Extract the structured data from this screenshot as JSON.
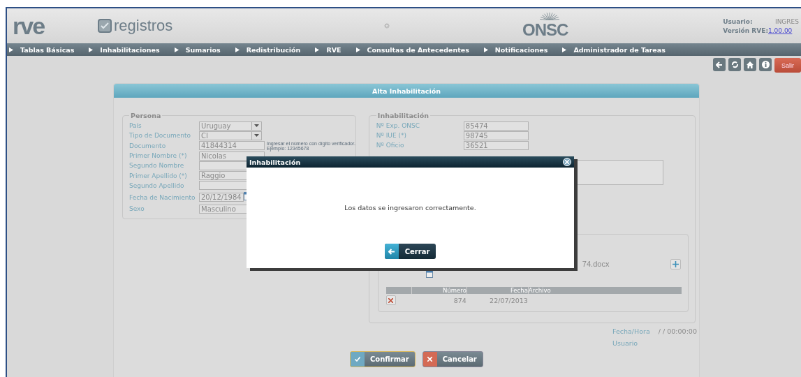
{
  "header": {
    "logo": "rve",
    "app_name": "registros",
    "agency": "ONSC",
    "user_label": "Usuario:",
    "user": "INGRES",
    "version_label": "Versión RVE:",
    "version": "1.00.00"
  },
  "nav": [
    "Tablas Básicas",
    "Inhabilitaciones",
    "Sumarios",
    "Redistribución",
    "RVE",
    "Consultas de Antecedentes",
    "Notificaciones",
    "Administrador de Tareas"
  ],
  "toolbar": {
    "exit": "Salir"
  },
  "form": {
    "title": "Alta Inhabilitación",
    "persona": {
      "legend": "Persona",
      "fields": [
        {
          "label": "País",
          "kind": "select",
          "value": "Uruguay"
        },
        {
          "label": "Tipo de Documento",
          "kind": "select",
          "value": "CI"
        },
        {
          "label": "Documento",
          "kind": "input",
          "value": "41844314",
          "hint": "Ingresar el número con dígito verificador.",
          "hint_example": "Ejemplo: 12345678"
        },
        {
          "label": "Primer Nombre (*)",
          "kind": "input",
          "value": "Nicolas"
        },
        {
          "label": "Segundo Nombre",
          "kind": "input"
        },
        {
          "label": "Primer Apellido (*)",
          "kind": "input",
          "value": "Raggio"
        },
        {
          "label": "Segundo Apellido",
          "kind": "input"
        },
        {
          "label": "Fecha de Nacimiento",
          "kind": "date",
          "value": "20/12/1984"
        },
        {
          "label": "Sexo",
          "kind": "input",
          "value": "Masculino"
        }
      ]
    },
    "inhabilitacion": {
      "legend": "Inhabilitación",
      "fields": [
        {
          "label": "Nº Exp. ONSC",
          "value": "85474"
        },
        {
          "label": "Nº IUE (*)",
          "value": "98745"
        },
        {
          "label": "Nº Oficio",
          "value": "36521"
        }
      ],
      "file_name": "74.docx",
      "table": {
        "columns": [
          "Número",
          "Fecha",
          "Archivo"
        ],
        "rows": [
          {
            "numero": "874",
            "fecha": "22/07/2013"
          }
        ]
      }
    },
    "audit": {
      "datetime_label": "Fecha/Hora",
      "datetime": "/ / 00:00:00",
      "user_label": "Usuario"
    },
    "buttons": [
      {
        "label": "Confirmar",
        "kind": "confirm"
      },
      {
        "label": "Cancelar",
        "kind": "cancel"
      }
    ]
  },
  "dialog": {
    "title": "Inhabilitación",
    "message": "Los datos se ingresaron correctamente.",
    "button": "Cerrar"
  }
}
